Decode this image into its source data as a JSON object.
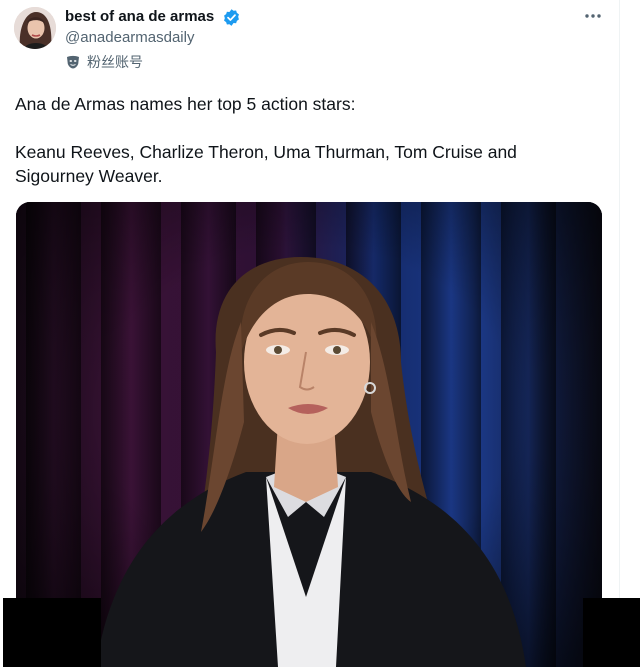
{
  "tweet": {
    "display_name": "best of ana de armas",
    "handle": "@anadearmasdaily",
    "fan_account_label": "粉丝账号",
    "text_line1": "Ana de Armas names her top 5 action stars:",
    "text_line2": "Keanu Reeves, Charlize Theron, Uma Thurman, Tom Cruise and",
    "text_line3": "Sigourney Weaver.",
    "icons": {
      "avatar": "profile-avatar",
      "verified": "verified-badge-icon",
      "fan": "mask-icon",
      "more": "more-options-icon"
    }
  },
  "media": {
    "kind": "video-frame",
    "subject": "woman in black blazer and white shirt in front of dark curtain"
  },
  "colors": {
    "text": "#0f1419",
    "secondary": "#536471",
    "verified": "#1d9bf0"
  }
}
